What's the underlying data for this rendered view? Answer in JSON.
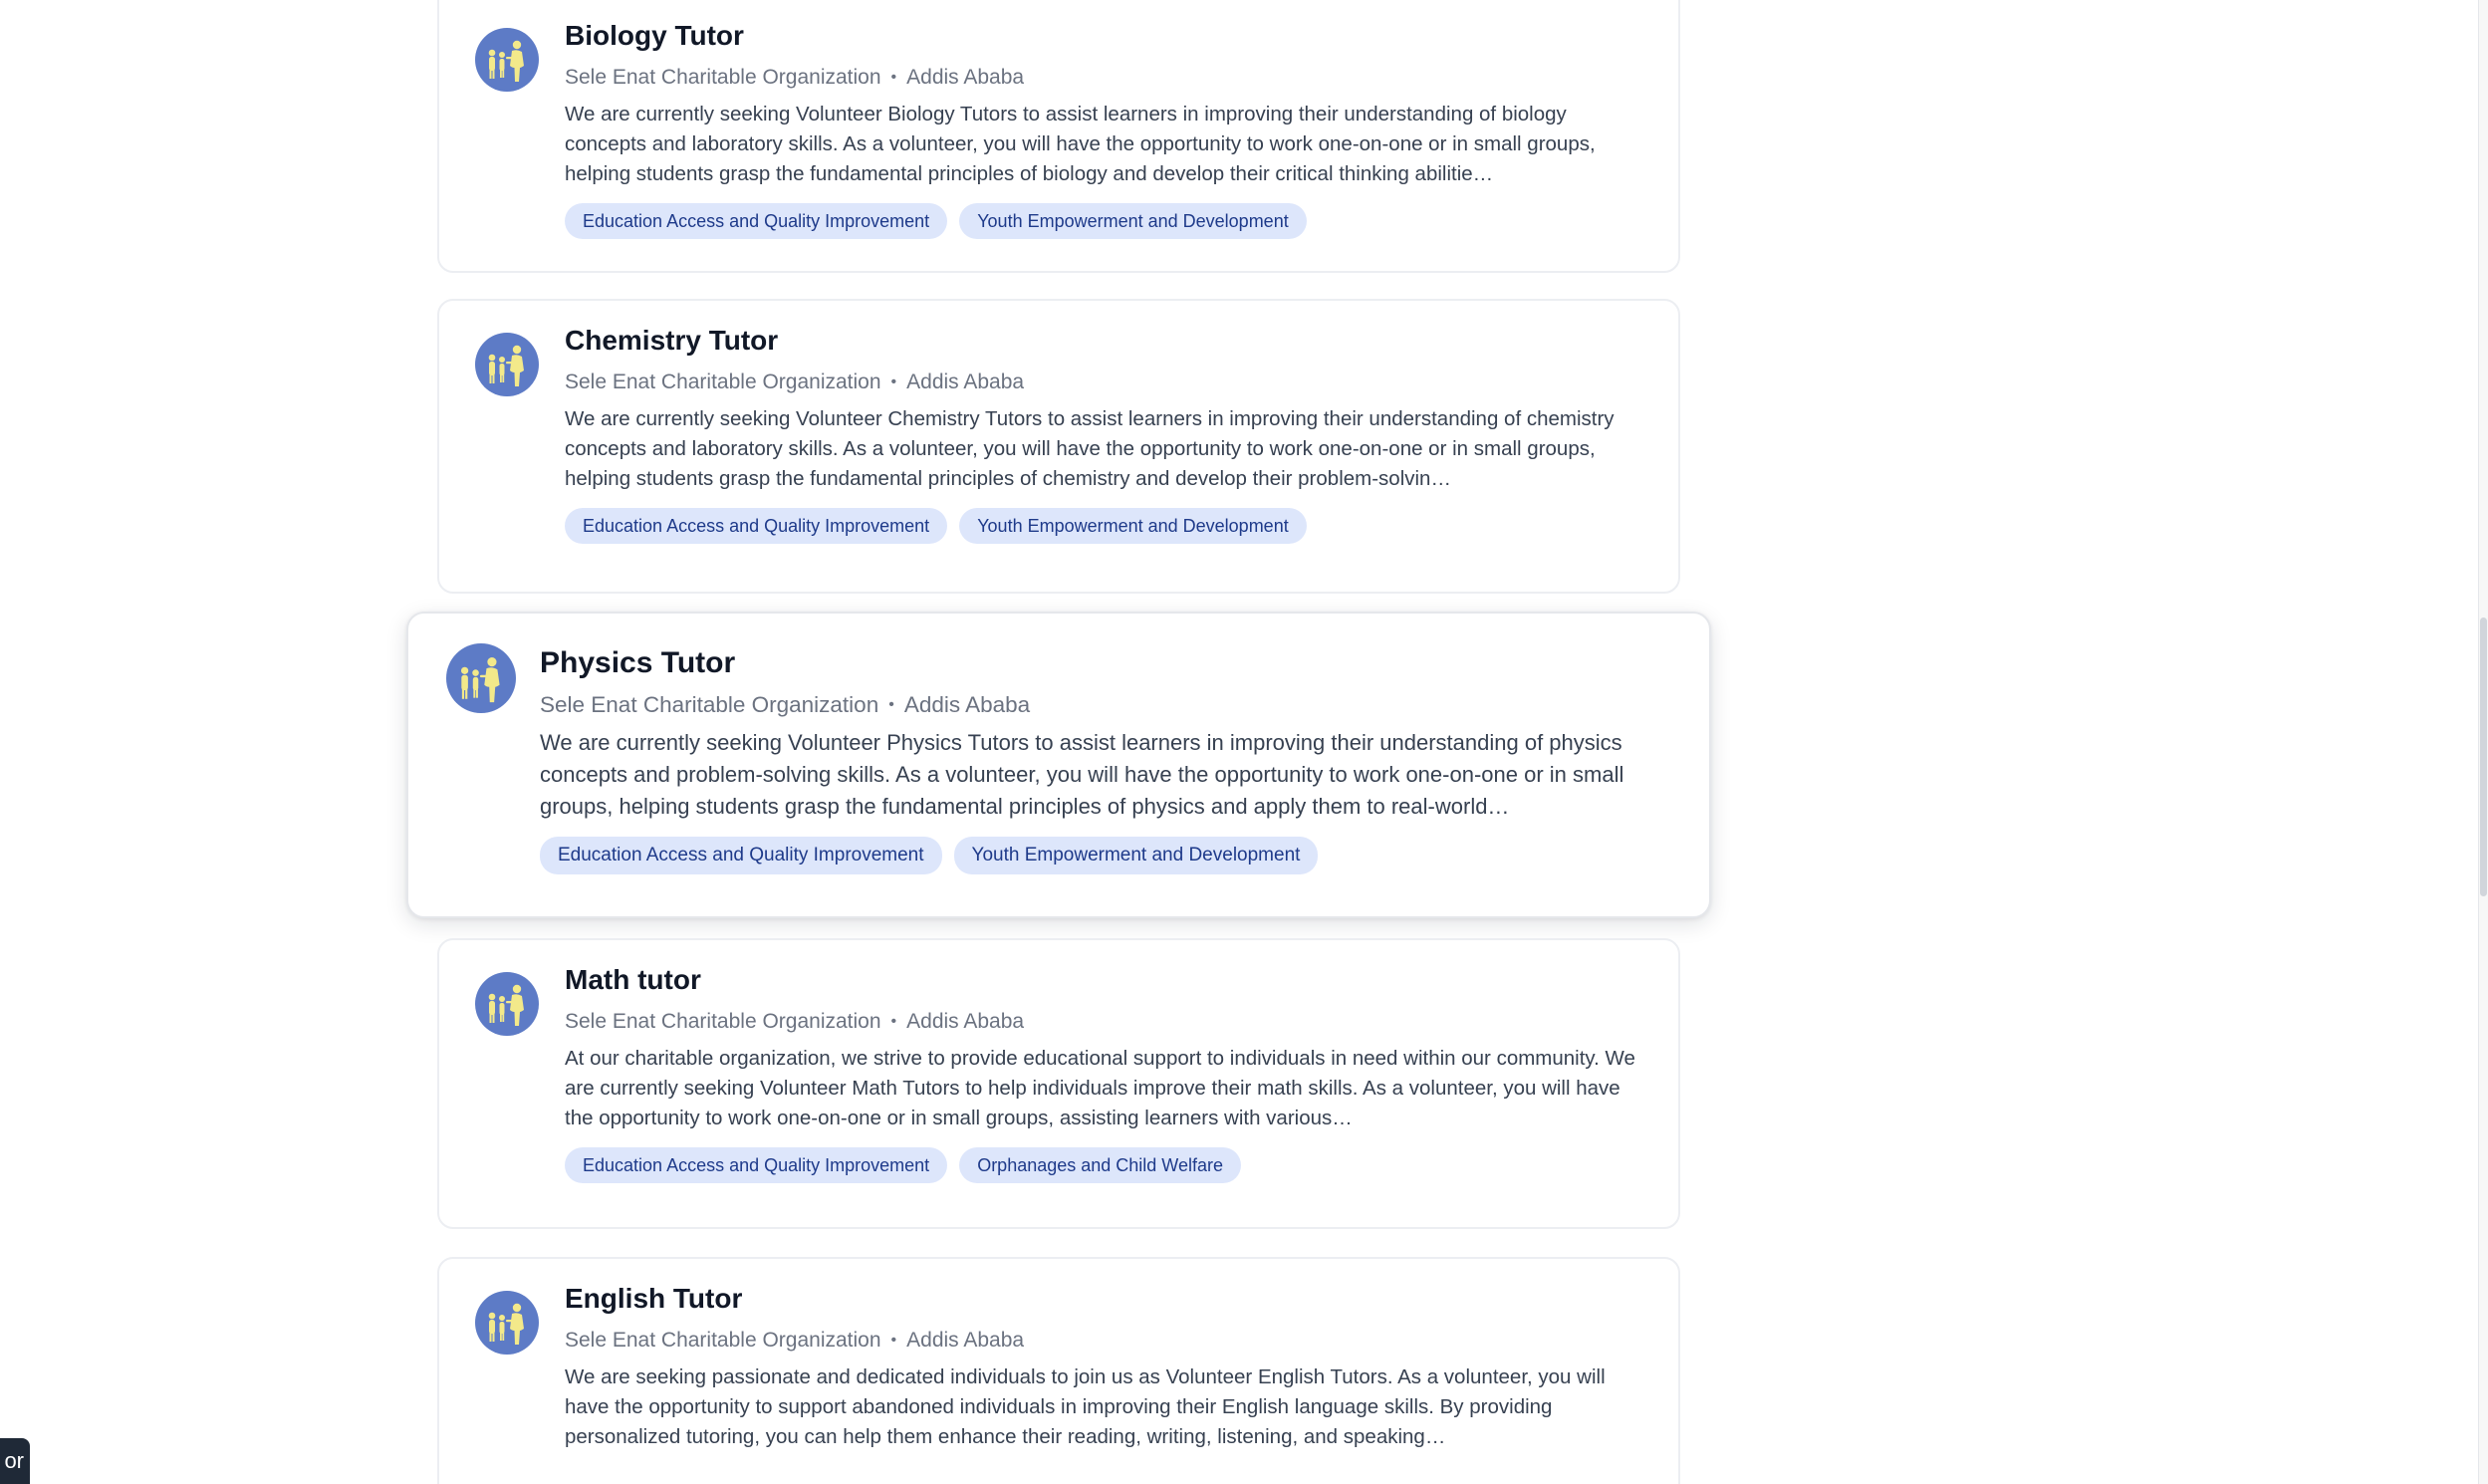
{
  "listings": [
    {
      "title": "Biology Tutor",
      "organization": "Sele Enat Charitable Organization",
      "separator": "•",
      "location": "Addis Ababa",
      "description": "We are currently seeking Volunteer Biology Tutors to assist learners in improving their understanding of biology concepts and laboratory skills. As a volunteer, you will have the opportunity to work one-on-one or in small groups, helping students grasp the fundamental principles of biology and develop their critical thinking abilitie…",
      "tags": [
        "Education Access and Quality Improvement",
        "Youth Empowerment and Development"
      ]
    },
    {
      "title": "Chemistry Tutor",
      "organization": "Sele Enat Charitable Organization",
      "separator": "•",
      "location": "Addis Ababa",
      "description": "We are currently seeking Volunteer Chemistry Tutors to assist learners in improving their understanding of chemistry concepts and laboratory skills. As a volunteer, you will have the opportunity to work one-on-one or in small groups, helping students grasp the fundamental principles of chemistry and develop their problem-solvin…",
      "tags": [
        "Education Access and Quality Improvement",
        "Youth Empowerment and Development"
      ]
    },
    {
      "title": "Physics Tutor",
      "organization": "Sele Enat Charitable Organization",
      "separator": "•",
      "location": "Addis Ababa",
      "description": "We are currently seeking Volunteer Physics Tutors to assist learners in improving their understanding of physics concepts and problem-solving skills. As a volunteer, you will have the opportunity to work one-on-one or in small groups, helping students grasp the fundamental principles of physics and apply them to real-world…",
      "tags": [
        "Education Access and Quality Improvement",
        "Youth Empowerment and Development"
      ]
    },
    {
      "title": "Math tutor",
      "organization": "Sele Enat Charitable Organization",
      "separator": "•",
      "location": "Addis Ababa",
      "description": "At our charitable organization, we strive to provide educational support to individuals in need within our community. We are currently seeking Volunteer Math Tutors to help individuals improve their math skills. As a volunteer, you will have the opportunity to work one-on-one or in small groups, assisting learners with various…",
      "tags": [
        "Education Access and Quality Improvement",
        "Orphanages and Child Welfare"
      ]
    },
    {
      "title": "English Tutor",
      "organization": "Sele Enat Charitable Organization",
      "separator": "•",
      "location": "Addis Ababa",
      "description": "We are seeking passionate and dedicated individuals to join us as Volunteer English Tutors. As a volunteer, you will have the opportunity to support abandoned individuals in improving their English language skills. By providing personalized tutoring, you can help them enhance their reading, writing, listening, and speaking…",
      "tags": []
    }
  ],
  "corner_chip": {
    "text": "or"
  },
  "colors": {
    "logo_background": "#5d7bc6",
    "logo_figures": "#f3e98a",
    "tag_background": "#dde6fb",
    "tag_text": "#1e3a8a",
    "title_text": "#111827",
    "meta_text": "#6b7280"
  },
  "icons": {
    "organization_logo": "family-icon"
  }
}
